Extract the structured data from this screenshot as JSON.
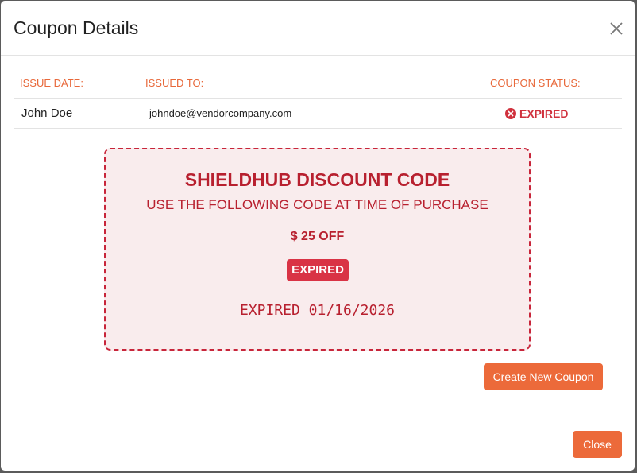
{
  "modal": {
    "title": "Coupon Details",
    "close_icon": "close-icon"
  },
  "table": {
    "headers": [
      "ISSUE DATE:",
      "ISSUED TO:",
      "COUPON STATUS:"
    ],
    "row": {
      "name": "John Doe",
      "email": "johndoe@vendorcompany.com",
      "status": "EXPIRED",
      "status_icon": "x-circle-icon"
    }
  },
  "coupon": {
    "title": "SHIELDHUB DISCOUNT CODE",
    "subtitle": "USE THE FOLLOWING CODE AT TIME OF PURCHASE",
    "amount": "$ 25 OFF",
    "badge": "EXPIRED",
    "expiry": "EXPIRED 01/16/2026"
  },
  "actions": {
    "create_label": "Create New Coupon",
    "close_label": "Close"
  },
  "colors": {
    "accent": "#ec6a3a",
    "danger": "#d0313d",
    "coupon_bg": "#f9eced"
  }
}
